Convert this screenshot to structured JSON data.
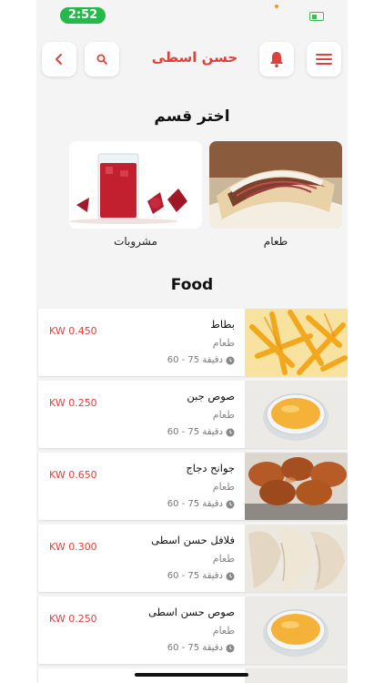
{
  "status_bar": {
    "time": "2:52"
  },
  "header": {
    "title": "حسن اسطى"
  },
  "categories_section": {
    "title": "اختر قسم",
    "items": [
      {
        "label": "طعام"
      },
      {
        "label": "مشروبات"
      }
    ]
  },
  "products_section": {
    "title": "Food",
    "items": [
      {
        "name": "بطاط",
        "category": "طعام",
        "time": "60 - 75 دقيقة",
        "price": "KW 0.450"
      },
      {
        "name": "صوص جبن",
        "category": "طعام",
        "time": "60 - 75 دقيقة",
        "price": "KW 0.250"
      },
      {
        "name": "جوانح دجاج",
        "category": "طعام",
        "time": "60 - 75 دقيقة",
        "price": "KW 0.650"
      },
      {
        "name": "فلافل حسن اسطى",
        "category": "طعام",
        "time": "60 - 75 دقيقة",
        "price": "KW 0.300"
      },
      {
        "name": "صوص حسن اسطى",
        "category": "طعام",
        "time": "60 - 75 دقيقة",
        "price": "KW 0.250"
      }
    ]
  },
  "colors": {
    "accent": "#e0403c",
    "time_pill": "#25b84a",
    "background": "#f4f4f4"
  },
  "icons": [
    "back-icon",
    "search-icon",
    "bell-icon",
    "menu-icon",
    "clock-icon"
  ]
}
